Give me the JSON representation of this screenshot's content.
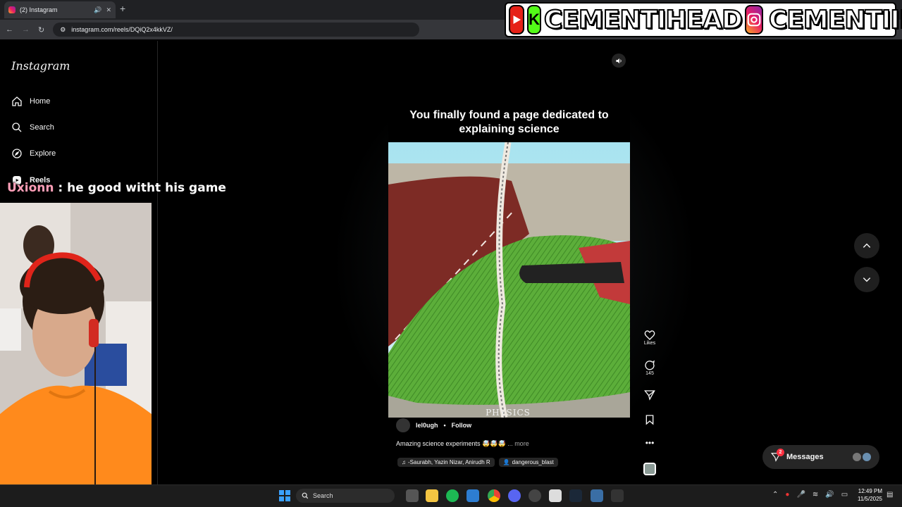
{
  "browser": {
    "tab_title": "(2) Instagram",
    "url": "instagram.com/reels/DQiQ2x4kkVZ/"
  },
  "banner": {
    "handle_one": "CEMENTIHEAD",
    "handle_two": "CEMENTIII",
    "kick_letter": "K"
  },
  "sidebar": {
    "logo": "Instagram",
    "items": [
      {
        "label": "Home",
        "icon": "home-icon"
      },
      {
        "label": "Search",
        "icon": "search-icon"
      },
      {
        "label": "Explore",
        "icon": "compass-icon"
      },
      {
        "label": "Reels",
        "icon": "reels-icon"
      }
    ]
  },
  "chat": {
    "user": "Uxionn",
    "message": ": he good witht his game"
  },
  "reel": {
    "overlay_text": "You finally found a page dedicated to explaining science",
    "watermark": "PHYSICS",
    "author": "lel0ugh",
    "follow_label": "Follow",
    "caption": "Amazing science experiments 🤯🤯🤯",
    "more_label": "... more",
    "audio": "-Saurabh, Yazin Nizar, Anirudh R",
    "tagged": "dangerous_blast",
    "likes_label": "Likes",
    "comments_count": "145"
  },
  "messages": {
    "label": "Messages",
    "badge": "2"
  },
  "taskbar": {
    "search_label": "Search",
    "time": "12:49 PM",
    "date": "11/5/2025"
  },
  "colors": {
    "youtube": "#e62117",
    "kick": "#53fc18",
    "twitter": "#1d9bf0",
    "notification": "#ff3040"
  }
}
